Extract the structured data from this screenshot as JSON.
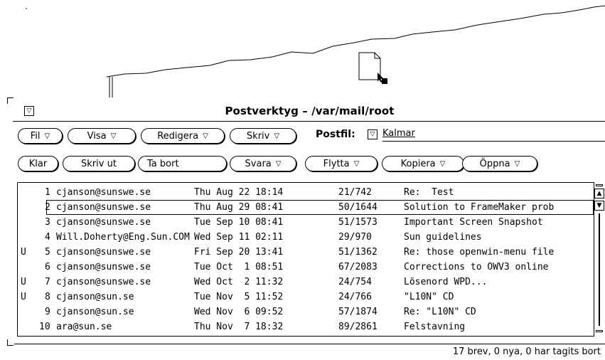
{
  "window": {
    "title": "Postverktyg – /var/mail/root"
  },
  "toolbar_row1": [
    {
      "label": "Fil",
      "has_menu": true
    },
    {
      "label": "Visa",
      "has_menu": true
    },
    {
      "label": "Redigera",
      "has_menu": true
    },
    {
      "label": "Skriv",
      "has_menu": true
    }
  ],
  "postfil": {
    "label": "Postfil:",
    "value": "Kalmar"
  },
  "toolbar_row2": [
    {
      "label": "Klar",
      "has_menu": false
    },
    {
      "label": "Skriv ut",
      "has_menu": false
    },
    {
      "label": "Ta bort",
      "has_menu": false
    },
    {
      "label": "Svara",
      "has_menu": true
    },
    {
      "label": "Flytta",
      "has_menu": true
    },
    {
      "label": "Kopiera",
      "has_menu": true
    },
    {
      "label": "Öppna",
      "has_menu": true
    }
  ],
  "messages": [
    {
      "flag": "",
      "num": "1",
      "sender": "cjanson@sunswe.se",
      "date": "Thu Aug 22 18:14",
      "size": "21/742",
      "subject": "Re:  Test",
      "selected": false
    },
    {
      "flag": "",
      "num": "2",
      "sender": "cjanson@sunswe.se",
      "date": "Thu Aug 29 08:41",
      "size": "50/1644",
      "subject": "Solution to FrameMaker prob",
      "selected": true
    },
    {
      "flag": "",
      "num": "3",
      "sender": "cjanson@sunswe.se",
      "date": "Tue Sep 10 08:41",
      "size": "51/1573",
      "subject": "Important Screen Snapshot",
      "selected": false
    },
    {
      "flag": "",
      "num": "4",
      "sender": "Will.Doherty@Eng.Sun.COM",
      "date": "Wed Sep 11 02:11",
      "size": "29/970",
      "subject": "Sun guidelines",
      "selected": false
    },
    {
      "flag": "U",
      "num": "5",
      "sender": "cjanson@sunswe.se",
      "date": "Fri Sep 20 13:41",
      "size": "51/1362",
      "subject": "Re: those openwin-menu file",
      "selected": false
    },
    {
      "flag": "",
      "num": "6",
      "sender": "cjanson@sunswe.se",
      "date": "Tue Oct  1 08:51",
      "size": "67/2083",
      "subject": "Corrections to OWV3 online",
      "selected": false
    },
    {
      "flag": "U",
      "num": "7",
      "sender": "cjanson@sunswe.se",
      "date": "Wed Oct  2 11:32",
      "size": "24/754",
      "subject": "Lösenord WPD...",
      "selected": false
    },
    {
      "flag": "U",
      "num": "8",
      "sender": "cjanson@sun.se",
      "date": "Tue Nov  5 11:52",
      "size": "24/766",
      "subject": "\"L10N\" CD",
      "selected": false
    },
    {
      "flag": "",
      "num": "9",
      "sender": "cjanson@sun.se",
      "date": "Wed Nov  6 09:52",
      "size": "57/1874",
      "subject": "Re: \"L10N\" CD",
      "selected": false
    },
    {
      "flag": "",
      "num": "10",
      "sender": "ara@sun.se",
      "date": "Thu Nov  7 18:32",
      "size": "89/2861",
      "subject": "Felstavning",
      "selected": false
    }
  ],
  "status": "17 brev, 0 nya, 0 har tagits bort",
  "icons": {
    "window_menu": "triangle-down-icon",
    "menu_indicator": "▽",
    "scroll_up": "▲",
    "scroll_down": "▼"
  }
}
